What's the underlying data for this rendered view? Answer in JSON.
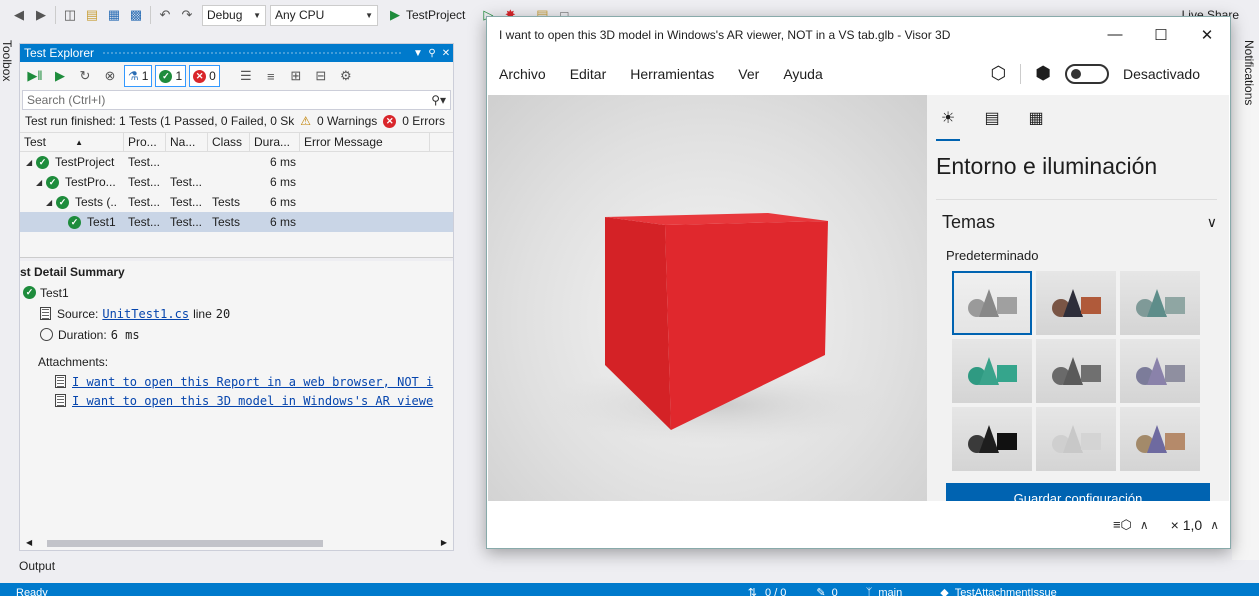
{
  "vs_toolbar": {
    "config": "Debug",
    "platform": "Any CPU",
    "run_target": "TestProject",
    "live_share": "Live Share"
  },
  "side_tabs": {
    "toolbox": "Toolbox",
    "notifications": "Notifications"
  },
  "test_explorer": {
    "title": "Test Explorer",
    "counts": {
      "total": "1",
      "passed": "1",
      "failed": "0"
    },
    "search_placeholder": "Search (Ctrl+I)",
    "summary": "Test run finished: 1 Tests (1 Passed, 0 Failed, 0 Sk",
    "warnings": "0 Warnings",
    "errors": "0 Errors",
    "columns": [
      "Test",
      "Pro...",
      "Na...",
      "Class",
      "Dura...",
      "Error Message"
    ],
    "rows": [
      {
        "name": "TestProject",
        "pro": "Test...",
        "na": "",
        "class": "",
        "dur": "6 ms"
      },
      {
        "name": "TestPro...",
        "pro": "Test...",
        "na": "Test...",
        "class": "",
        "dur": "6 ms"
      },
      {
        "name": "Tests (..",
        "pro": "Test...",
        "na": "Test...",
        "class": "Tests",
        "dur": "6 ms"
      },
      {
        "name": "Test1",
        "pro": "Test...",
        "na": "Test...",
        "class": "Tests",
        "dur": "6 ms"
      }
    ],
    "detail": {
      "title": "st Detail Summary",
      "test_name": "Test1",
      "source_label": "Source:",
      "source_file": "UnitTest1.cs",
      "source_line_label": "line",
      "source_line": "20",
      "duration_label": "Duration:",
      "duration": "6 ms",
      "attachments_label": "Attachments:",
      "attachments": [
        "I want to open this Report in a web browser, NOT i",
        "I want to open this 3D model in Windows's AR viewe"
      ]
    }
  },
  "output_tab": "Output",
  "statusbar": {
    "ready": "Ready",
    "lines": "0 / 0",
    "errors": "0",
    "branch": "main",
    "repo": "TestAttachmentIssue"
  },
  "viewer": {
    "title": "I want to open this 3D model in Windows's AR viewer, NOT in a VS tab.glb - Visor 3D",
    "menu": [
      "Archivo",
      "Editar",
      "Herramientas",
      "Ver",
      "Ayuda"
    ],
    "toggle_label": "Desactivado",
    "panel": {
      "heading": "Entorno e iluminación",
      "themes": "Temas",
      "default_label": "Predeterminado",
      "save_button": "Guardar configuración"
    },
    "footer": {
      "zoom": "× 1,0"
    },
    "cube_color": "#e0282d",
    "accent": "#0063b1"
  }
}
